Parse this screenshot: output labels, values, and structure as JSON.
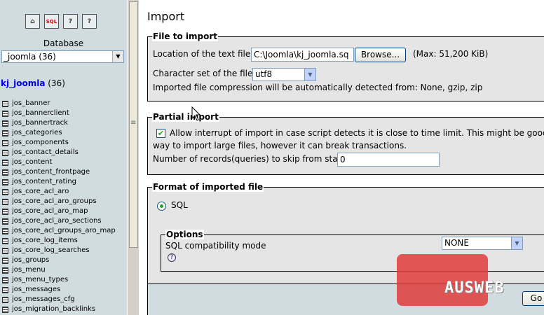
{
  "nav": {
    "database_label": "Database",
    "db_select_value": "_joomla (36)",
    "db_title_link": "kj_joomla",
    "db_title_count": "(36)",
    "icon_buttons": [
      {
        "name": "home-icon",
        "label": "⌂"
      },
      {
        "name": "sql-icon",
        "label": "SQL"
      },
      {
        "name": "docs-icon",
        "label": "?"
      },
      {
        "name": "query-icon",
        "label": "?"
      }
    ],
    "tables": [
      "jos_banner",
      "jos_bannerclient",
      "jos_bannertrack",
      "jos_categories",
      "jos_components",
      "jos_contact_details",
      "jos_content",
      "jos_content_frontpage",
      "jos_content_rating",
      "jos_core_acl_aro",
      "jos_core_acl_aro_groups",
      "jos_core_acl_aro_map",
      "jos_core_acl_aro_sections",
      "jos_core_acl_groups_aro_map",
      "jos_core_log_items",
      "jos_core_log_searches",
      "jos_groups",
      "jos_menu",
      "jos_menu_types",
      "jos_messages",
      "jos_messages_cfg",
      "jos_migration_backlinks"
    ]
  },
  "main": {
    "title": "Import",
    "file_section": {
      "legend": "File to import",
      "location_label": "Location of the text file",
      "location_value": "C:\\Joomla\\kj_joomla.sq",
      "browse_label": "Browse...",
      "max_label": "(Max: 51,200 KiB)",
      "charset_label": "Character set of the file:",
      "charset_value": "utf8",
      "compression_note": "Imported file compression will be automatically detected from: None, gzip, zip"
    },
    "partial_section": {
      "legend": "Partial import",
      "allow_interrupt_line1": "Allow interrupt of import in case script detects it is close to time limit. This might be good",
      "allow_interrupt_line2": "way to import large files, however it can break transactions.",
      "allow_interrupt_checked": true,
      "skip_label": "Number of records(queries) to skip from start",
      "skip_value": "0"
    },
    "format_section": {
      "legend": "Format of imported file",
      "format_option": "SQL",
      "options_legend": "Options",
      "compat_label": "SQL compatibility mode",
      "compat_value": "NONE"
    },
    "go_label": "Go"
  },
  "watermark": "AUSWEB"
}
